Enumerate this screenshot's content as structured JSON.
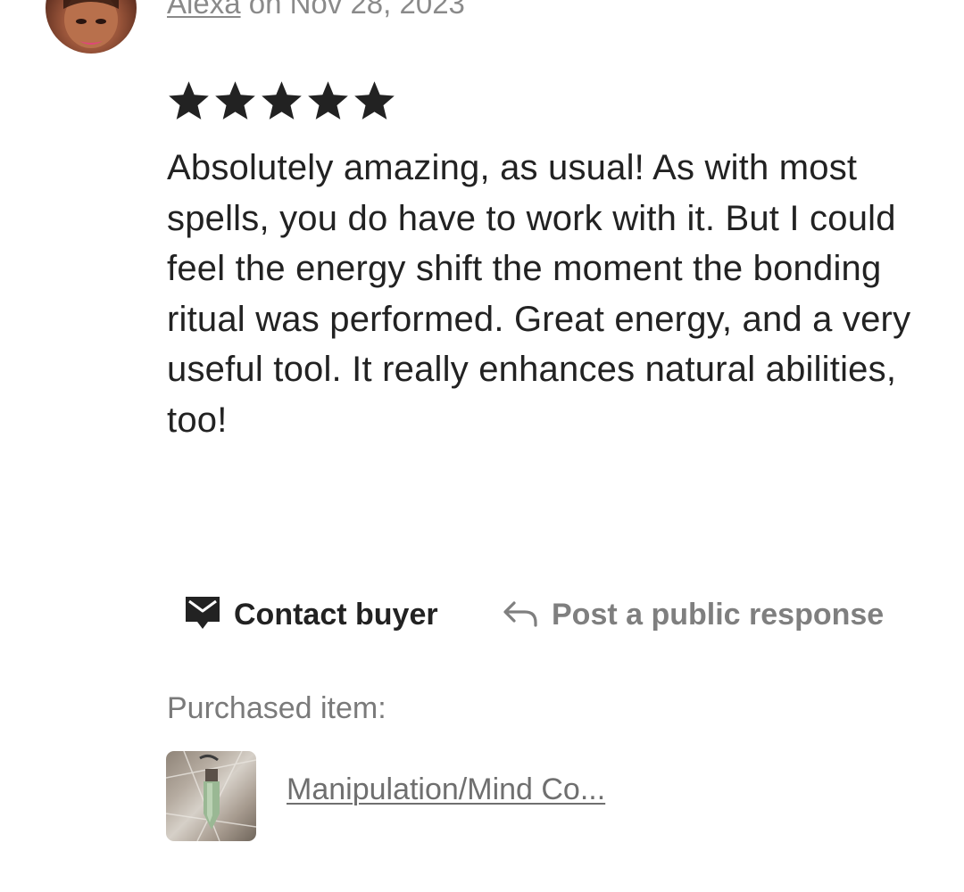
{
  "review": {
    "author": "Alexa",
    "date_text": " on Nov 28, 2023",
    "rating": 5,
    "rating_max": 5,
    "star_color": "#222222",
    "body": "Absolutely amazing, as usual! As with most spells, you do have to work with it. But I could feel the energy shift the moment the bonding ritual was performed. Great energy, and a very useful tool. It really enhances natural abilities, too!"
  },
  "actions": {
    "contact_label": "Contact buyer",
    "contact_icon": "envelope-icon",
    "respond_label": "Post a public response",
    "respond_icon": "reply-arrow-icon"
  },
  "purchase": {
    "label": "Purchased item:",
    "item_title": "Manipulation/Mind Co..."
  }
}
